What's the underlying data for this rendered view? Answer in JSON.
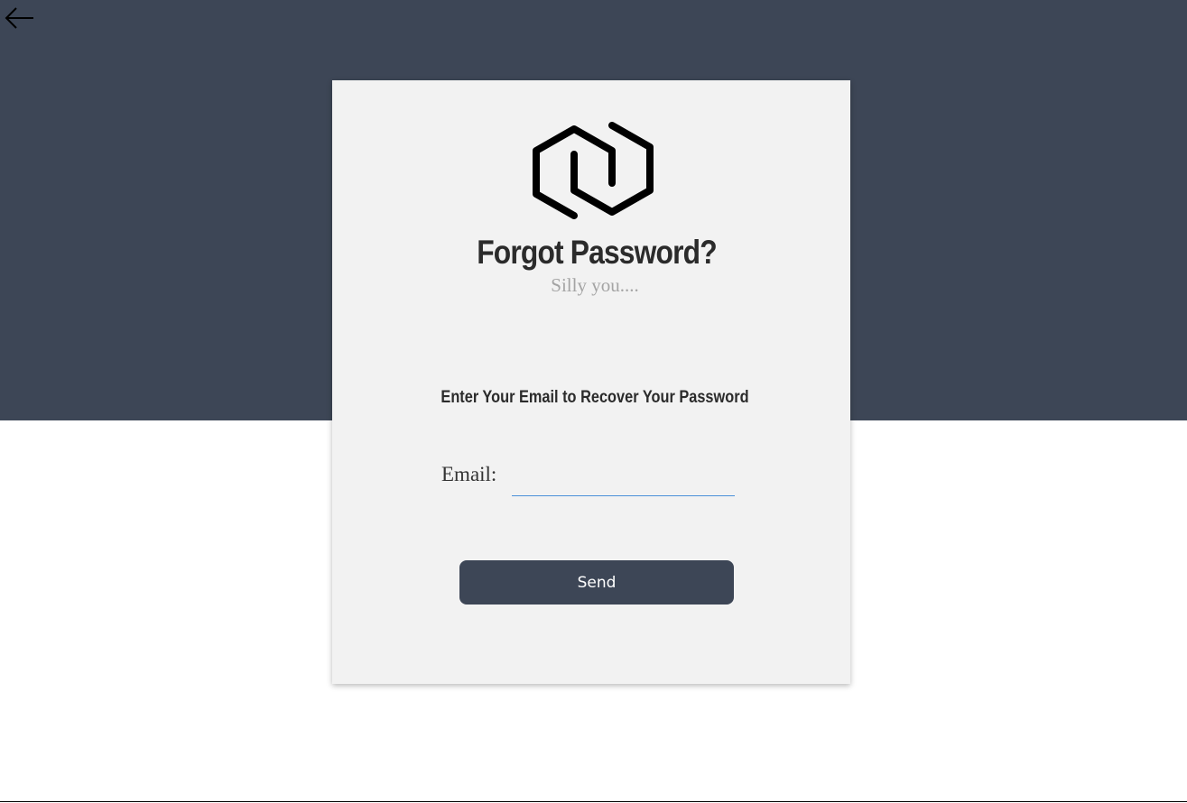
{
  "colors": {
    "header_band": "#3d4656",
    "card_background": "#f2f2f2",
    "button_background": "#3d4656",
    "button_text": "#ffffff",
    "input_underline": "#4a90d9",
    "title_text": "#2b2b2b",
    "subtitle_text": "#a4a4a4"
  },
  "navigation": {
    "back_icon": "arrow-left-icon"
  },
  "card": {
    "logo_icon": "hexagon-link-logo",
    "title": "Forgot Password?",
    "subtitle": "Silly you....",
    "instruction": "Enter Your Email to Recover Your Password",
    "email_label": "Email:",
    "email_value": "",
    "submit_label": "Send"
  }
}
